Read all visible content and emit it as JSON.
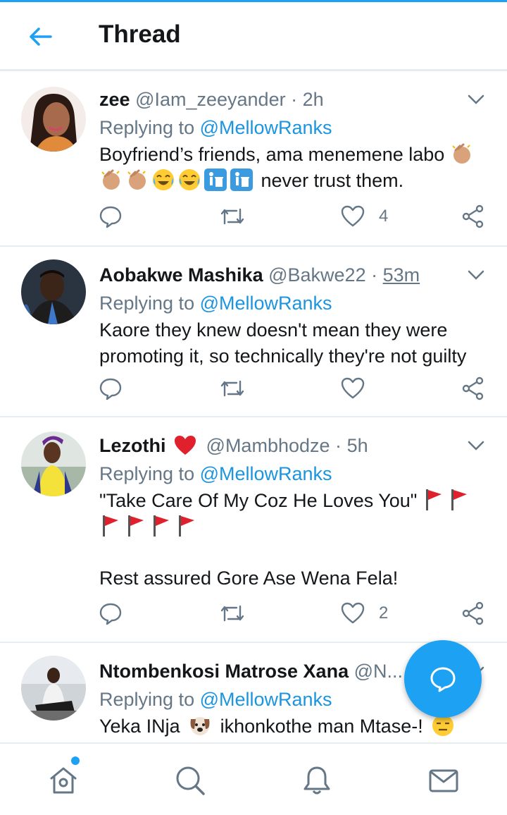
{
  "header": {
    "title": "Thread"
  },
  "tweets": [
    {
      "name": "zee",
      "handle": "@Iam_zeeyander",
      "dot": "·",
      "time": "2h",
      "replying_prefix": "Replying to ",
      "replying_to": "@MellowRanks",
      "text_a": "Boyfriend’s friends, ama menemene labo",
      "text_b": "never trust them.",
      "likes": "4"
    },
    {
      "name": "Aobakwe Mashika",
      "handle": "@Bakwe22",
      "dot": "·",
      "time": "53m",
      "replying_prefix": "Replying to ",
      "replying_to": "@MellowRanks",
      "text_lines": [
        "Kaore they knew doesn't mean they were",
        "promoting it, so technically they're not guilty"
      ],
      "likes": ""
    },
    {
      "name": "Lezothi",
      "handle": "@Mambhodze",
      "dot": "·",
      "time": "5h",
      "replying_prefix": "Replying to ",
      "replying_to": "@MellowRanks",
      "text_a": "\"Take Care Of My Coz He Loves You\"",
      "text_c": "Rest assured Gore Ase Wena Fela!",
      "likes": "2"
    },
    {
      "name": "Ntombenkosi Matrose Xana",
      "handle": "@N...",
      "replying_prefix": "Replying to ",
      "replying_to": "@MellowRanks",
      "text_a": "Yeka INja",
      "text_b": "ikhonkothe man Mtase-!"
    }
  ],
  "icons": {
    "back": "arrow-left-icon",
    "reply": "speech-bubble-icon",
    "retweet": "retweet-icon",
    "like": "heart-icon",
    "share": "share-icon",
    "compose": "compose-reply-icon",
    "nav": [
      "home-icon",
      "search-icon",
      "bell-icon",
      "mail-icon"
    ]
  },
  "colors": {
    "accent": "#1da1f2",
    "link": "#1b95e0",
    "muted": "#657786",
    "text": "#14171a",
    "divider": "#e6ecf0"
  }
}
